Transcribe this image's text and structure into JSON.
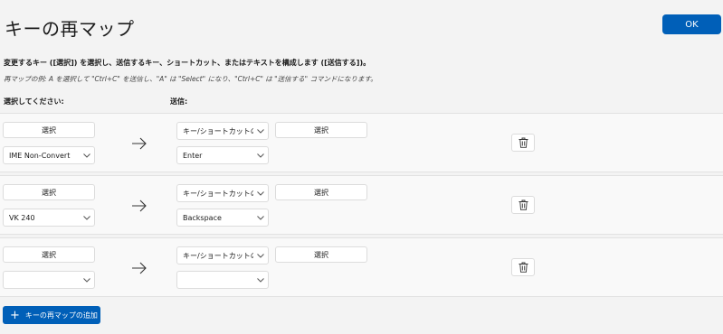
{
  "window": {
    "title": "キーの再マップ"
  },
  "ok_label": "OK",
  "description": "変更するキー ([選択]) を選択し、送信するキー、ショートカット、またはテキストを構成します ([送信する])。",
  "example": "再マップの例: A を選択して \"Ctrl+C\" を送信し、\"A\" は \"Select\" になり、\"Ctrl+C\" は \"送信する\" コマンドになります。",
  "headers": {
    "select": "選択してください:",
    "send": "送信:"
  },
  "rows": [
    {
      "select_label": "選択",
      "source_value": "IME Non-Convert",
      "type_value": "キー/ショートカットの送",
      "target_select_label": "選択",
      "target_value": "Enter"
    },
    {
      "select_label": "選択",
      "source_value": "VK 240",
      "type_value": "キー/ショートカットの送",
      "target_select_label": "選択",
      "target_value": "Backspace"
    },
    {
      "select_label": "選択",
      "source_value": "",
      "type_value": "キー/ショートカットの送",
      "target_select_label": "選択",
      "target_value": ""
    }
  ],
  "add_label": "キーの再マップの追加",
  "icons": {
    "arrow": "arrow-right-icon",
    "delete": "trash-icon",
    "chevron": "chevron-down-icon",
    "add": "plus-icon"
  },
  "colors": {
    "accent": "#005fb8",
    "background": "#f3f3f3",
    "row": "#f9f9f9"
  }
}
